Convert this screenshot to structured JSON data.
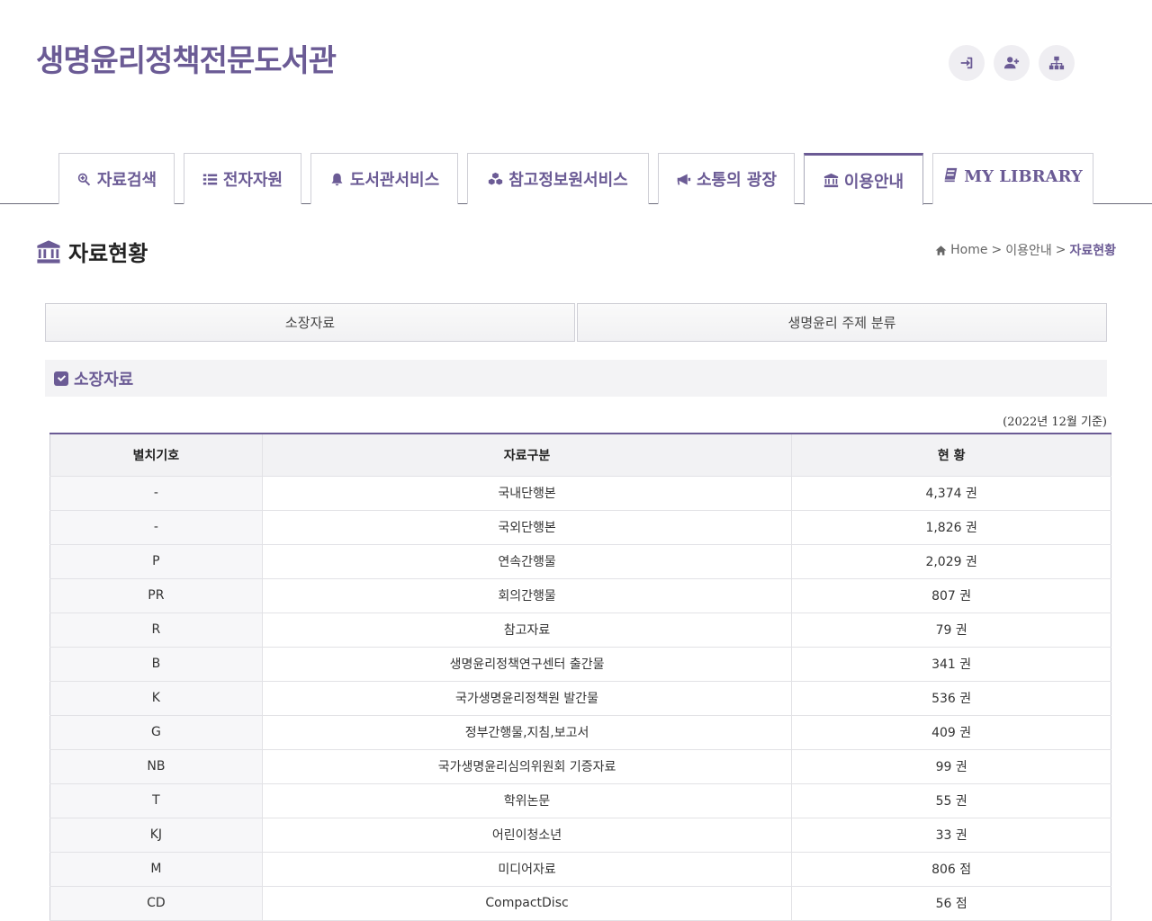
{
  "header": {
    "site_title": "생명윤리정책전문도서관",
    "icons": [
      "login-icon",
      "join-icon",
      "sitemap-icon"
    ]
  },
  "nav": {
    "tabs": [
      {
        "label": "자료검색",
        "icon": "search-plus-icon"
      },
      {
        "label": "전자자원",
        "icon": "list-icon"
      },
      {
        "label": "도서관서비스",
        "icon": "bell-icon"
      },
      {
        "label": "참고정보원서비스",
        "icon": "cubes-icon"
      },
      {
        "label": "소통의 광장",
        "icon": "bullhorn-icon"
      },
      {
        "label": "이용안내",
        "icon": "bank-icon"
      },
      {
        "label": "MY LIBRARY",
        "icon": "book-icon"
      }
    ],
    "active_tab": "이용안내"
  },
  "page": {
    "title": "자료현황",
    "breadcrumb": {
      "home": "Home",
      "sep1": ">",
      "parent": "이용안내",
      "sep2": ">",
      "current": "자료현황"
    }
  },
  "subtabs": [
    "소장자료",
    "생명윤리 주제 분류"
  ],
  "section": {
    "title": "소장자료",
    "basis": "(2022년 12월 기준)"
  },
  "table": {
    "headers": [
      "별치기호",
      "자료구분",
      "현 황"
    ],
    "rows": [
      [
        "-",
        "국내단행본",
        "4,374 권"
      ],
      [
        "-",
        "국외단행본",
        "1,826 권"
      ],
      [
        "P",
        "연속간행물",
        "2,029 권"
      ],
      [
        "PR",
        "회의간행물",
        "807 권"
      ],
      [
        "R",
        "참고자료",
        "79 권"
      ],
      [
        "B",
        "생명윤리정책연구센터 출간물",
        "341 권"
      ],
      [
        "K",
        "국가생명윤리정책원 발간물",
        "536 권"
      ],
      [
        "G",
        "정부간행물,지침,보고서",
        "409 권"
      ],
      [
        "NB",
        "국가생명윤리심의위원회 기증자료",
        "99 권"
      ],
      [
        "T",
        "학위논문",
        "55 권"
      ],
      [
        "KJ",
        "어린이청소년",
        "33 권"
      ],
      [
        "M",
        "미디어자료",
        "806 점"
      ],
      [
        "CD",
        "CompactDisc",
        "56 점"
      ]
    ]
  },
  "colors": {
    "accent": "#6b5b95",
    "table_border": "#e2e2e6",
    "header_bg": "#f2f2f4"
  }
}
